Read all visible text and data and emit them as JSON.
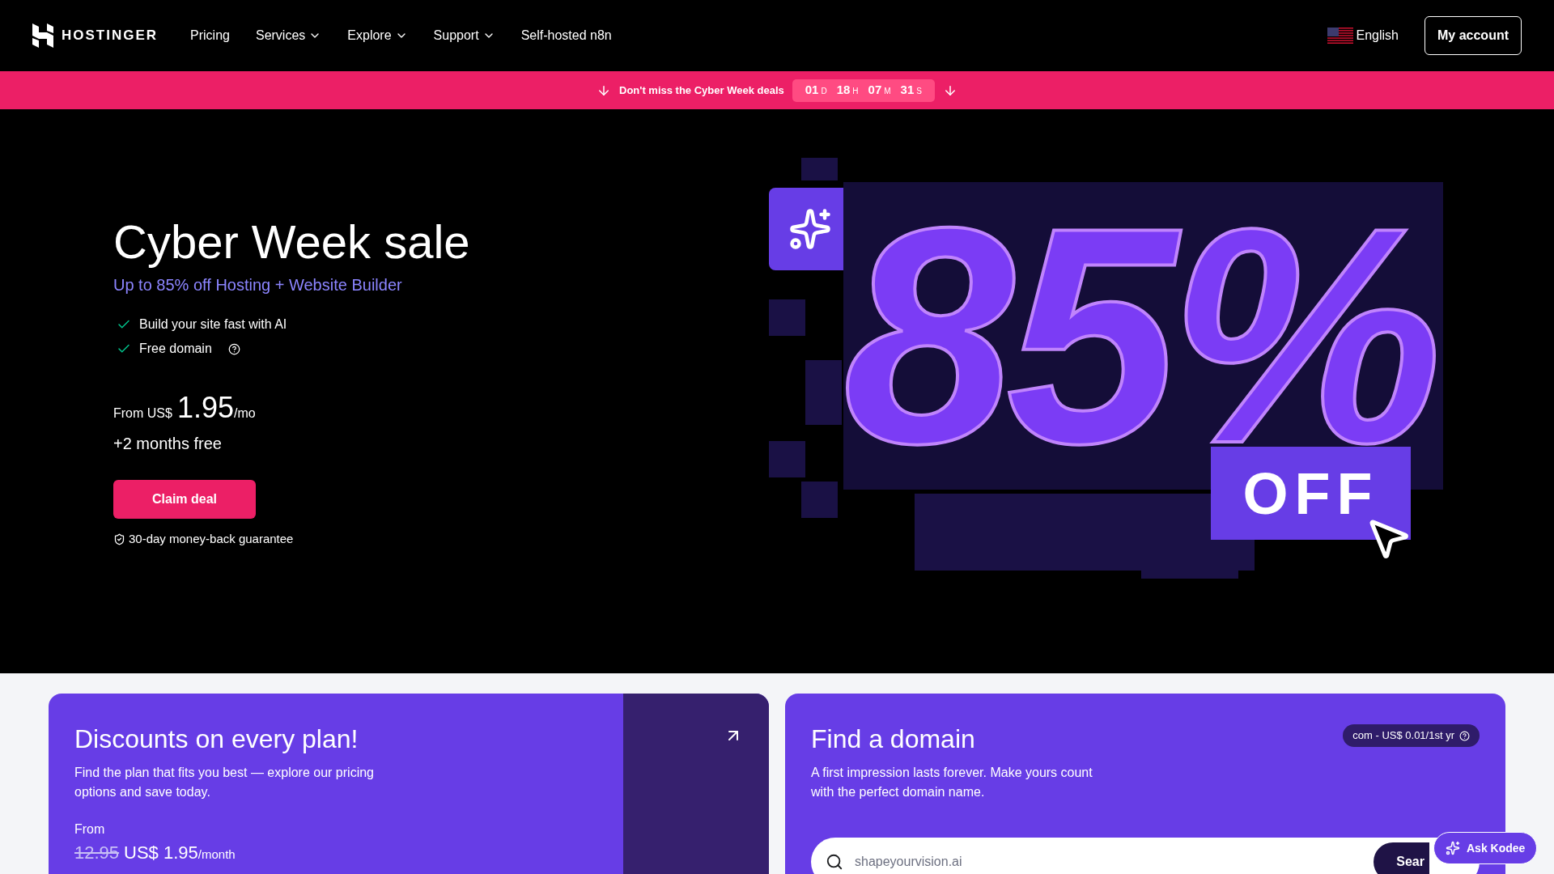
{
  "header": {
    "logo": "HOSTINGER",
    "nav": [
      {
        "label": "Pricing",
        "dropdown": false
      },
      {
        "label": "Services",
        "dropdown": true
      },
      {
        "label": "Explore",
        "dropdown": true
      },
      {
        "label": "Support",
        "dropdown": true
      },
      {
        "label": "Self-hosted n8n",
        "dropdown": false
      }
    ],
    "language": "English",
    "account_button": "My account"
  },
  "promo_bar": {
    "text": "Don't miss the Cyber Week deals",
    "countdown": [
      {
        "value": "01",
        "unit": "D"
      },
      {
        "value": "18",
        "unit": "H"
      },
      {
        "value": "07",
        "unit": "M"
      },
      {
        "value": "31",
        "unit": "S"
      }
    ]
  },
  "hero": {
    "title": "Cyber Week sale",
    "subtitle": "Up to 85% off Hosting + Website Builder",
    "features": [
      {
        "text": "Build your site fast with AI",
        "info": false
      },
      {
        "text": "Free domain",
        "info": true
      }
    ],
    "price_prefix": "From US$",
    "price": "1.95",
    "price_suffix": "/mo",
    "bonus": "+2 months free",
    "cta": "Claim deal",
    "guarantee": "30-day money-back guarantee",
    "banner_big": "85%",
    "banner_tag": "OFF"
  },
  "cards": [
    {
      "kind": "plans",
      "title": "Discounts on every plan!",
      "text": "Find the plan that fits you best — explore our pricing options and save today.",
      "from_label": "From",
      "old_price": "12.95",
      "new_price": "US$ 1.95",
      "period": "/month"
    },
    {
      "kind": "domain",
      "title": "Find a domain",
      "text": "A first impression lasts forever. Make yours count with the perfect domain name.",
      "badge": "com - US$ 0.01/1st yr",
      "placeholder": "shapeyourvision.ai",
      "button": "Sear"
    }
  ],
  "chat_button": "Ask Kodee"
}
